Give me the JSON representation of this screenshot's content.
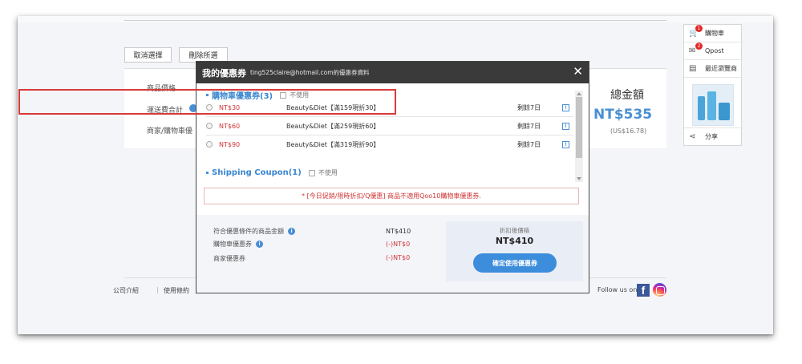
{
  "background": {
    "buttons": [
      "取消選擇",
      "刪除所選"
    ],
    "labels": [
      "商品價格",
      "運送費合計",
      "商家/購物車優"
    ],
    "total_title": "總金額",
    "total_amount": "NT$535",
    "total_usd": "(US$16.78)"
  },
  "side_panel": {
    "items": [
      {
        "label": "購物車",
        "icon": "cart-icon",
        "badge": "1"
      },
      {
        "label": "Qpost",
        "icon": "mail-icon",
        "badge": "2"
      },
      {
        "label": "最近瀏覽商",
        "icon": "history-icon"
      }
    ],
    "share_label": "分享"
  },
  "modal": {
    "title": "我的優惠券",
    "subtitle": "ting525claire@hotmail.com的優惠券資料",
    "close_label": "✕",
    "cart_coupons": {
      "title": "購物車優惠券(3)",
      "no_use_label": "不使用",
      "items": [
        {
          "amount": "NT$30",
          "desc": "Beauty&Diet【滿159現折30】",
          "days": "剩餘7日"
        },
        {
          "amount": "NT$60",
          "desc": "Beauty&Diet【滿259現折60】",
          "days": "剩餘7日"
        },
        {
          "amount": "NT$90",
          "desc": "Beauty&Diet【滿319現折90】",
          "days": "剩餘7日"
        }
      ]
    },
    "shipping_coupons": {
      "title": "Shipping Coupon(1)",
      "no_use_label": "不使用"
    },
    "notice": "* [今日促銷/限時折扣/Q優惠] 商品不適用Qoo10購物車優惠券.",
    "summary": {
      "eligible_label": "符合優惠條件的商品金額",
      "eligible_value": "NT$410",
      "cart_coupon_label": "購物車優惠券",
      "cart_coupon_value": "(-)NT$0",
      "shop_coupon_label": "商家優惠券",
      "shop_coupon_value": "(-)NT$0",
      "after_label": "折扣後價格",
      "after_value": "NT$410",
      "confirm_label": "確定使用優惠券"
    }
  },
  "footer": {
    "links": [
      "公司介紹",
      "使用條約"
    ],
    "follow_label": "Follow us on"
  },
  "colors": {
    "accent": "#3a86d0",
    "price_red": "#d03535",
    "highlight": "#d83a3a",
    "header_dark": "#3a3a3a"
  }
}
